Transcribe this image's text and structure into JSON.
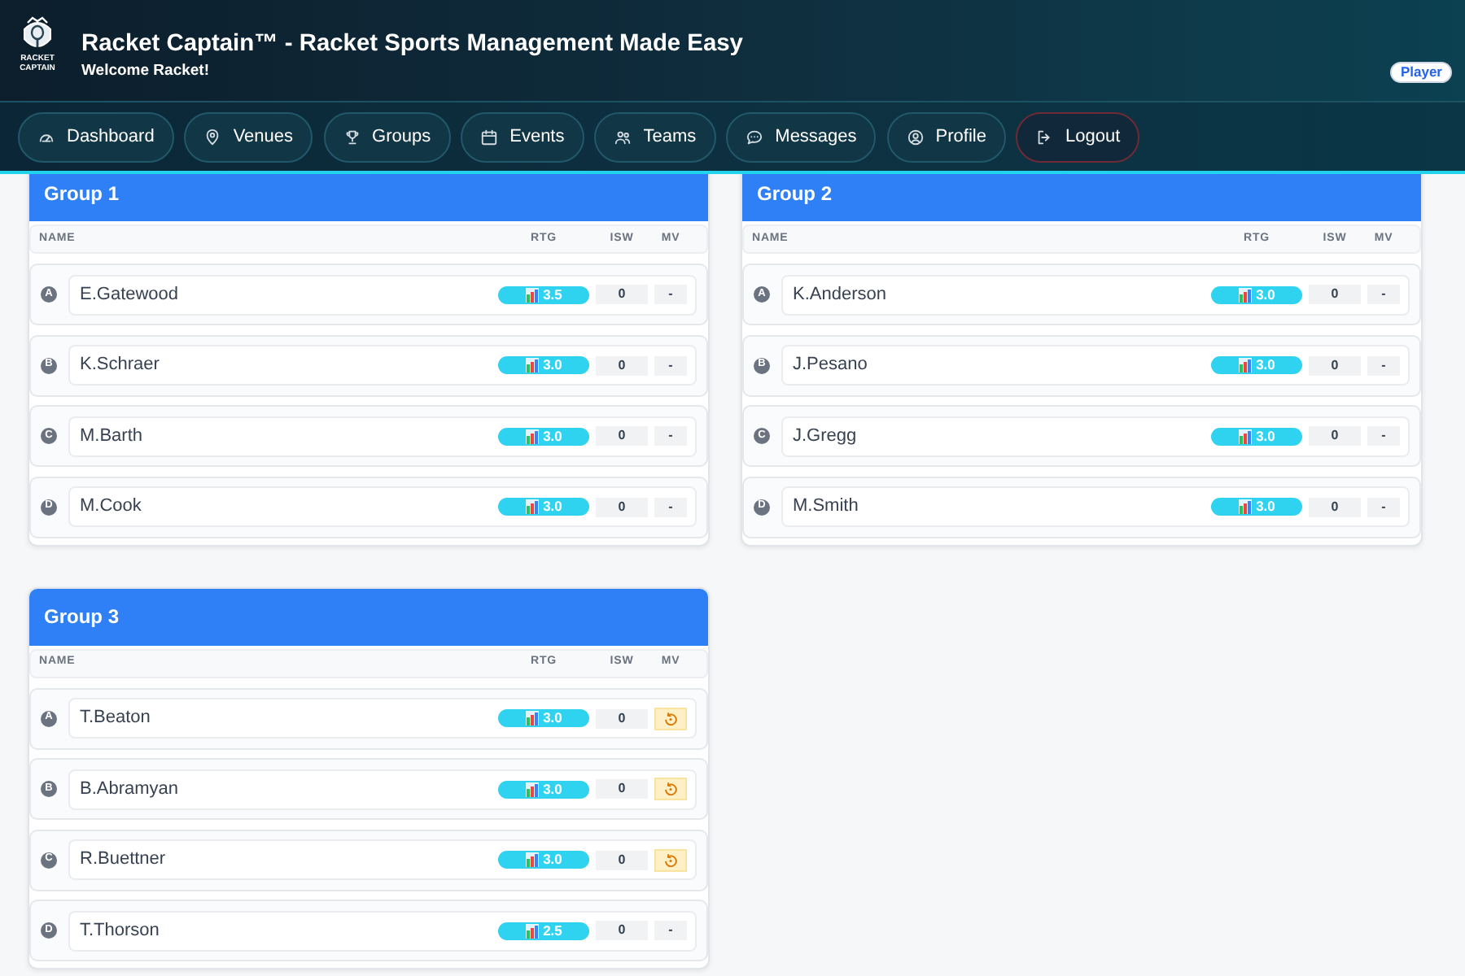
{
  "header": {
    "logo": {
      "line_1": "RACKET",
      "line_2": "CAPTAIN"
    },
    "title": "Racket Captain™ - Racket Sports Management Made Easy",
    "subtitle": "Welcome Racket!",
    "role_badge": "Player"
  },
  "nav": [
    {
      "label": "Dashboard",
      "kind": "link"
    },
    {
      "label": "Venues",
      "kind": "link"
    },
    {
      "label": "Groups",
      "kind": "link"
    },
    {
      "label": "Events",
      "kind": "link"
    },
    {
      "label": "Teams",
      "kind": "link"
    },
    {
      "label": "Messages",
      "kind": "link"
    },
    {
      "label": "Profile",
      "kind": "link"
    },
    {
      "label": "Logout",
      "kind": "logout"
    }
  ],
  "groups": [
    {
      "title": "Group 1",
      "columns": [
        "NAME",
        "RTG",
        "ISW",
        "MV"
      ],
      "players": [
        {
          "position": "A",
          "name": "E.Gatewood",
          "rating": "3.5",
          "isw": "0",
          "mv": {
            "kind": "text",
            "text": "-"
          }
        },
        {
          "position": "B",
          "name": "K.Schraer",
          "rating": "3.0",
          "isw": "0",
          "mv": {
            "kind": "text",
            "text": "-"
          }
        },
        {
          "position": "C",
          "name": "M.Barth",
          "rating": "3.0",
          "isw": "0",
          "mv": {
            "kind": "text",
            "text": "-"
          }
        },
        {
          "position": "D",
          "name": "M.Cook",
          "rating": "3.0",
          "isw": "0",
          "mv": {
            "kind": "text",
            "text": "-"
          }
        }
      ]
    },
    {
      "title": "Group 2",
      "columns": [
        "NAME",
        "RTG",
        "ISW",
        "MV"
      ],
      "players": [
        {
          "position": "A",
          "name": "K.Anderson",
          "rating": "3.0",
          "isw": "0",
          "mv": {
            "kind": "text",
            "text": "-"
          }
        },
        {
          "position": "B",
          "name": "J.Pesano",
          "rating": "3.0",
          "isw": "0",
          "mv": {
            "kind": "text",
            "text": "-"
          }
        },
        {
          "position": "C",
          "name": "J.Gregg",
          "rating": "3.0",
          "isw": "0",
          "mv": {
            "kind": "text",
            "text": "-"
          }
        },
        {
          "position": "D",
          "name": "M.Smith",
          "rating": "3.0",
          "isw": "0",
          "mv": {
            "kind": "text",
            "text": "-"
          }
        }
      ]
    },
    {
      "title": "Group 3",
      "columns": [
        "NAME",
        "RTG",
        "ISW",
        "MV"
      ],
      "players": [
        {
          "position": "A",
          "name": "T.Beaton",
          "rating": "3.0",
          "isw": "0",
          "mv": {
            "kind": "button"
          }
        },
        {
          "position": "B",
          "name": "B.Abramyan",
          "rating": "3.0",
          "isw": "0",
          "mv": {
            "kind": "button"
          }
        },
        {
          "position": "C",
          "name": "R.Buettner",
          "rating": "3.0",
          "isw": "0",
          "mv": {
            "kind": "button"
          }
        },
        {
          "position": "D",
          "name": "T.Thorson",
          "rating": "2.5",
          "isw": "0",
          "mv": {
            "kind": "text",
            "text": "-"
          }
        }
      ]
    }
  ]
}
